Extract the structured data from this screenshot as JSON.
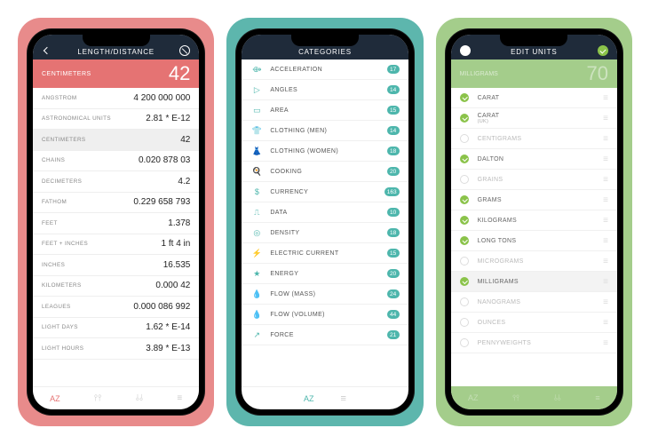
{
  "cards": {
    "bg1": "#e88b8b",
    "bg2": "#5db6ad",
    "bg3": "#a4cd8b"
  },
  "screen1": {
    "title": "LENGTH/DISTANCE",
    "hero_label": "CENTIMETERS",
    "hero_value": "42",
    "rows": [
      {
        "name": "ANGSTROM",
        "value": "4 200 000 000"
      },
      {
        "name": "ASTRONOMICAL UNITS",
        "value": "2.81 * E-12"
      },
      {
        "name": "CENTIMETERS",
        "value": "42",
        "selected": true
      },
      {
        "name": "CHAINS",
        "value": "0.020 878 03"
      },
      {
        "name": "DECIMETERS",
        "value": "4.2"
      },
      {
        "name": "FATHOM",
        "value": "0.229 658 793"
      },
      {
        "name": "FEET",
        "value": "1.378"
      },
      {
        "name": "FEET + INCHES",
        "value": "1 ft 4 in"
      },
      {
        "name": "INCHES",
        "value": "16.535"
      },
      {
        "name": "KILOMETERS",
        "value": "0.000 42"
      },
      {
        "name": "LEAGUES",
        "value": "0.000 086 992"
      },
      {
        "name": "LIGHT DAYS",
        "value": "1.62 * E-14"
      },
      {
        "name": "LIGHT HOURS",
        "value": "3.89 * E-13"
      }
    ],
    "bottom": {
      "az": "AZ"
    }
  },
  "screen2": {
    "title": "CATEGORIES",
    "rows": [
      {
        "icon": "⟴",
        "name": "ACCELERATION",
        "count": "17"
      },
      {
        "icon": "▷",
        "name": "ANGLES",
        "count": "14"
      },
      {
        "icon": "▭",
        "name": "AREA",
        "count": "15"
      },
      {
        "icon": "👕",
        "name": "CLOTHING (MEN)",
        "count": "14"
      },
      {
        "icon": "👗",
        "name": "CLOTHING (WOMEN)",
        "count": "18"
      },
      {
        "icon": "🍳",
        "name": "COOKING",
        "count": "20"
      },
      {
        "icon": "$",
        "name": "CURRENCY",
        "count": "163"
      },
      {
        "icon": "⎍",
        "name": "DATA",
        "count": "10"
      },
      {
        "icon": "◎",
        "name": "DENSITY",
        "count": "18"
      },
      {
        "icon": "⚡",
        "name": "ELECTRIC CURRENT",
        "count": "15"
      },
      {
        "icon": "★",
        "name": "ENERGY",
        "count": "20"
      },
      {
        "icon": "💧",
        "name": "FLOW (MASS)",
        "count": "24"
      },
      {
        "icon": "💧",
        "name": "FLOW (VOLUME)",
        "count": "44"
      },
      {
        "icon": "↗",
        "name": "FORCE",
        "count": "21"
      }
    ],
    "bottom": {
      "az": "AZ"
    }
  },
  "screen3": {
    "title": "EDIT UNITS",
    "hero_label": "MILLIGRAMS",
    "hero_value": "70",
    "rows": [
      {
        "on": true,
        "name": "CARAT"
      },
      {
        "on": true,
        "name": "CARAT",
        "sub": "(UK)"
      },
      {
        "on": false,
        "name": "CENTIGRAMS"
      },
      {
        "on": true,
        "name": "DALTON"
      },
      {
        "on": false,
        "name": "GRAINS"
      },
      {
        "on": true,
        "name": "GRAMS"
      },
      {
        "on": true,
        "name": "KILOGRAMS"
      },
      {
        "on": true,
        "name": "LONG TONS"
      },
      {
        "on": false,
        "name": "MICROGRAMS"
      },
      {
        "on": true,
        "name": "MILLIGRAMS",
        "selected": true
      },
      {
        "on": false,
        "name": "NANOGRAMS"
      },
      {
        "on": false,
        "name": "OUNCES"
      },
      {
        "on": false,
        "name": "PENNYWEIGHTS"
      }
    ],
    "bottom": {
      "az": "AZ"
    }
  }
}
